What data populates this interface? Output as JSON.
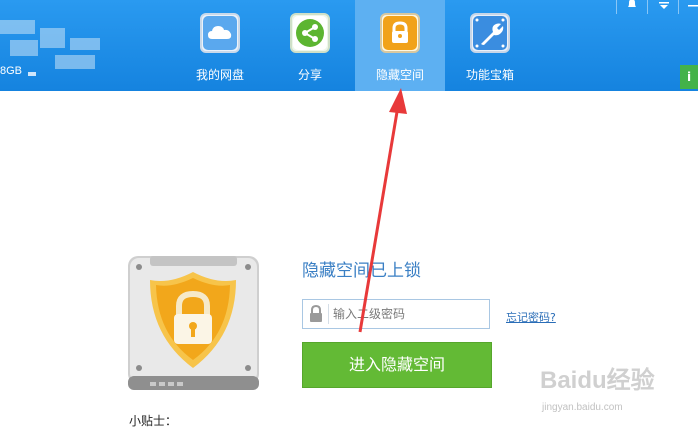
{
  "top_bar": {
    "quota_text": "8GB",
    "tabs": [
      {
        "label": "我的网盘",
        "icon": "cloud-icon",
        "active": false
      },
      {
        "label": "分享",
        "icon": "share-icon",
        "active": false
      },
      {
        "label": "隐藏空间",
        "icon": "lock-icon",
        "active": true
      },
      {
        "label": "功能宝箱",
        "icon": "wrench-icon",
        "active": false
      }
    ],
    "window_controls": [
      "bell-icon",
      "dropdown-icon",
      "minimize-icon"
    ],
    "side_badge": "i"
  },
  "main": {
    "title": "隐藏空间已上锁",
    "password": {
      "placeholder": "输入二级密码",
      "value": ""
    },
    "forgot_link": "忘记密码?",
    "enter_button": "进入隐藏空间",
    "tips_label": "小贴士："
  },
  "watermark": {
    "main": "Baidu经验",
    "sub": "jingyan.baidu.com"
  },
  "colors": {
    "top_bar": "#1f8fe8",
    "active_tab": "#5db0f2",
    "enter_button": "#63ba35",
    "title": "#3a7fc4",
    "arrow": "#e8393a"
  }
}
